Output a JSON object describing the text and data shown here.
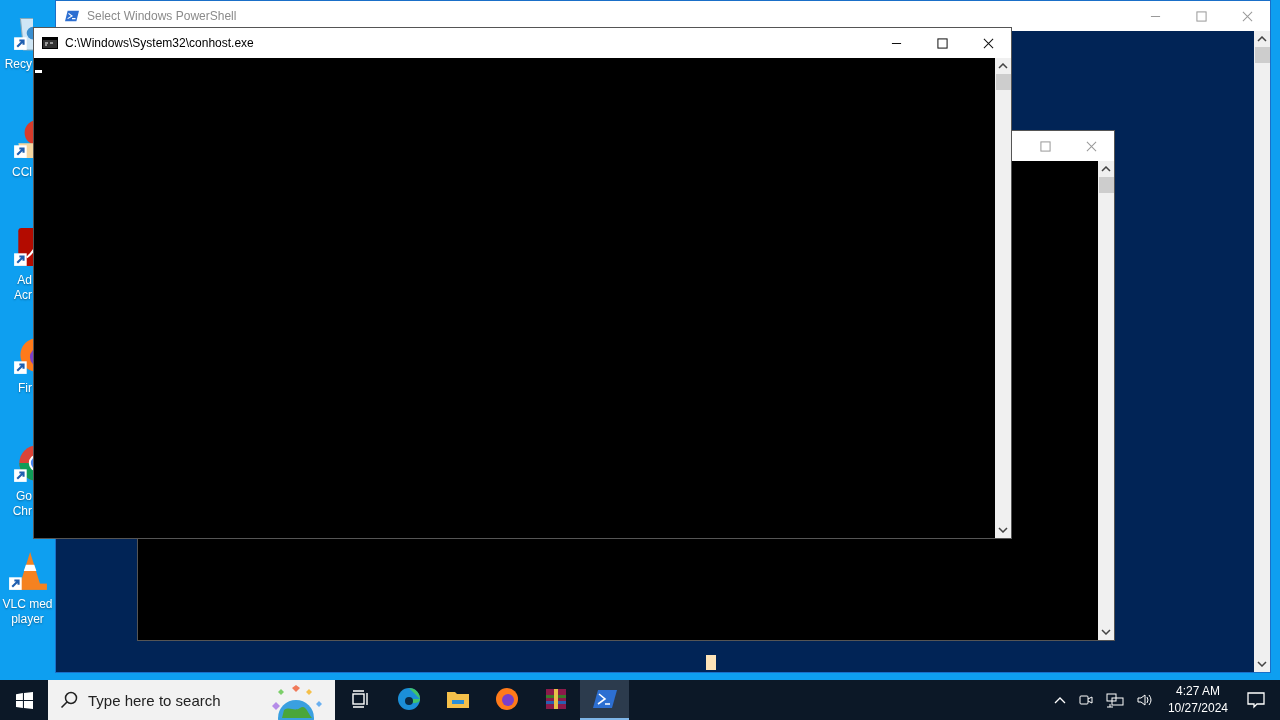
{
  "desktop_icons": [
    {
      "kind": "recycle",
      "lines": [
        "Recy"
      ]
    },
    {
      "kind": "ccleaner",
      "lines": [
        "CCl"
      ]
    },
    {
      "kind": "acrobat",
      "lines": [
        "Ad",
        "Acr"
      ]
    },
    {
      "kind": "firefox",
      "lines": [
        "Fir"
      ]
    },
    {
      "kind": "chrome",
      "lines": [
        "Go",
        "Chr"
      ]
    },
    {
      "kind": "vlc",
      "lines": [
        "VLC med",
        "player"
      ]
    }
  ],
  "windows": [
    {
      "kind": "powershell",
      "title": "Select Windows PowerShell",
      "active": false
    },
    {
      "kind": "console",
      "active": false
    },
    {
      "kind": "conhost",
      "title": "C:\\Windows\\System32\\conhost.exe",
      "active": true
    }
  ],
  "taskbar": {
    "search": {
      "placeholder": "Type here to search"
    },
    "apps": [
      {
        "kind": "taskview",
        "selected": false
      },
      {
        "kind": "edge",
        "selected": false
      },
      {
        "kind": "explorer",
        "selected": false
      },
      {
        "kind": "firefox",
        "selected": false
      },
      {
        "kind": "winrar",
        "selected": false
      },
      {
        "kind": "powershell",
        "selected": true
      }
    ],
    "time": "4:27 AM",
    "date": "10/27/2024"
  }
}
